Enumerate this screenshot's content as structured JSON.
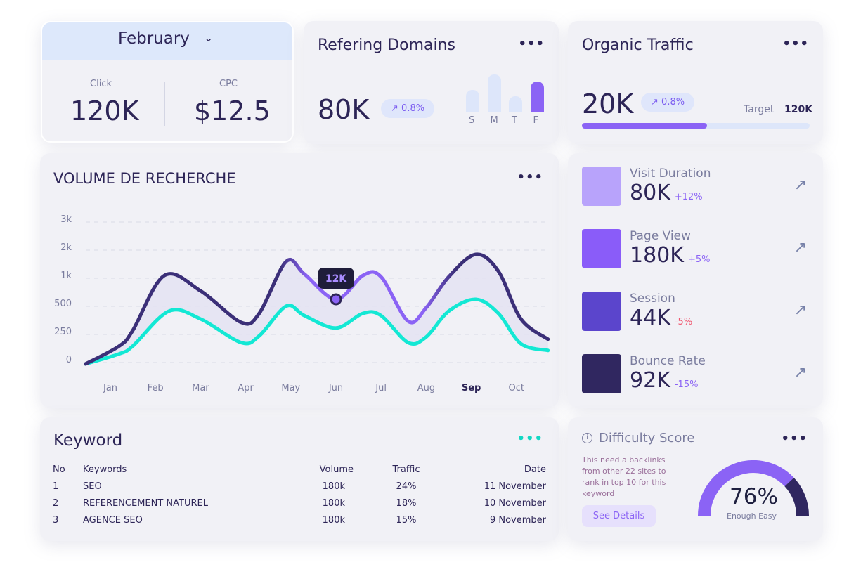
{
  "month_card": {
    "month": "February",
    "click_label": "Click",
    "click_value": "120K",
    "cpc_label": "CPC",
    "cpc_value": "$12.5"
  },
  "referring": {
    "title": "Refering Domains",
    "value": "80K",
    "change": "0.8%",
    "bars": [
      {
        "label": "S",
        "level": 0.6
      },
      {
        "label": "M",
        "level": 1.0
      },
      {
        "label": "T",
        "level": 0.42
      },
      {
        "label": "F",
        "level": 0.82
      }
    ]
  },
  "organic": {
    "title": "Organic Traffic",
    "value": "20K",
    "change": "0.8%",
    "target_label": "Target",
    "target_value": "120K",
    "progress": 0.55
  },
  "volume": {
    "title": "VOLUME DE RECHERCHE",
    "tooltip": "12K"
  },
  "chart_data": {
    "type": "line",
    "title": "VOLUME DE RECHERCHE",
    "y_ticks": [
      "3k",
      "2k",
      "1k",
      "500",
      "250",
      "0"
    ],
    "y_tick_values": [
      3000,
      2000,
      1000,
      500,
      250,
      0
    ],
    "categories": [
      "Jan",
      "Feb",
      "Mar",
      "Apr",
      "May",
      "Jun",
      "Jul",
      "Aug",
      "Sep",
      "Oct"
    ],
    "highlight_category": "Sep",
    "grid": true,
    "series": [
      {
        "color": "#3b2f78",
        "highlight_color": "#8b63f5",
        "points": [
          [
            -0.55,
            0
          ],
          [
            0.2,
            160
          ],
          [
            0.5,
            300
          ],
          [
            1.2,
            1150
          ],
          [
            2.0,
            800
          ],
          [
            2.9,
            370
          ],
          [
            3.3,
            450
          ],
          [
            3.9,
            1650
          ],
          [
            4.3,
            1200
          ],
          [
            5.0,
            650
          ],
          [
            5.6,
            1150
          ],
          [
            6.0,
            1100
          ],
          [
            6.6,
            380
          ],
          [
            7.0,
            500
          ],
          [
            7.5,
            1100
          ],
          [
            8.1,
            1900
          ],
          [
            8.6,
            1300
          ],
          [
            9.1,
            400
          ],
          [
            9.7,
            220
          ]
        ]
      },
      {
        "color": "#13e8d4",
        "points": [
          [
            -0.55,
            0
          ],
          [
            0.2,
            90
          ],
          [
            0.5,
            160
          ],
          [
            1.3,
            470
          ],
          [
            2.0,
            400
          ],
          [
            2.9,
            190
          ],
          [
            3.3,
            250
          ],
          [
            3.9,
            530
          ],
          [
            4.3,
            430
          ],
          [
            5.0,
            320
          ],
          [
            5.6,
            450
          ],
          [
            6.0,
            430
          ],
          [
            6.6,
            190
          ],
          [
            7.0,
            240
          ],
          [
            7.5,
            470
          ],
          [
            8.1,
            650
          ],
          [
            8.6,
            450
          ],
          [
            9.1,
            180
          ],
          [
            9.7,
            120
          ]
        ]
      }
    ],
    "tooltip": {
      "category": "Jun",
      "label": "12K",
      "value": 650
    }
  },
  "metrics": [
    {
      "label": "Visit Duration",
      "value": "80K",
      "change": "+12%",
      "color": "#b8a3fb",
      "change_color": "#8b63f5",
      "icon": "clock"
    },
    {
      "label": "Page View",
      "value": "180K",
      "change": "+5%",
      "color": "#8a5cf9",
      "change_color": "#8b63f5",
      "icon": "eye"
    },
    {
      "label": "Session",
      "value": "44K",
      "change": "-5%",
      "color": "#5b45cc",
      "change_color": "#f0566e",
      "icon": "session"
    },
    {
      "label": "Bounce Rate",
      "value": "92K",
      "change": "-15%",
      "color": "#302760",
      "change_color": "#8b63f5",
      "icon": "bounce"
    }
  ],
  "keyword": {
    "title": "Keyword",
    "headers": [
      "No",
      "Keywords",
      "Volume",
      "Traffic",
      "Date"
    ],
    "rows": [
      [
        "1",
        "SEO",
        "180k",
        "24%",
        "11 November"
      ],
      [
        "2",
        "REFERENCEMENT NATUREL",
        "180k",
        "18%",
        "10 November"
      ],
      [
        "3",
        "AGENCE SEO",
        "180k",
        "15%",
        "9 November"
      ]
    ]
  },
  "difficulty": {
    "title": "Difficulty Score",
    "description": "This need a backlinks from other 22 sites to rank in top 10 for this keyword",
    "button": "See Details",
    "score": "76%",
    "score_value": 76,
    "score_label": "Enough Easy",
    "colors": {
      "fill": "#8b63f5",
      "rest": "#302760"
    }
  }
}
